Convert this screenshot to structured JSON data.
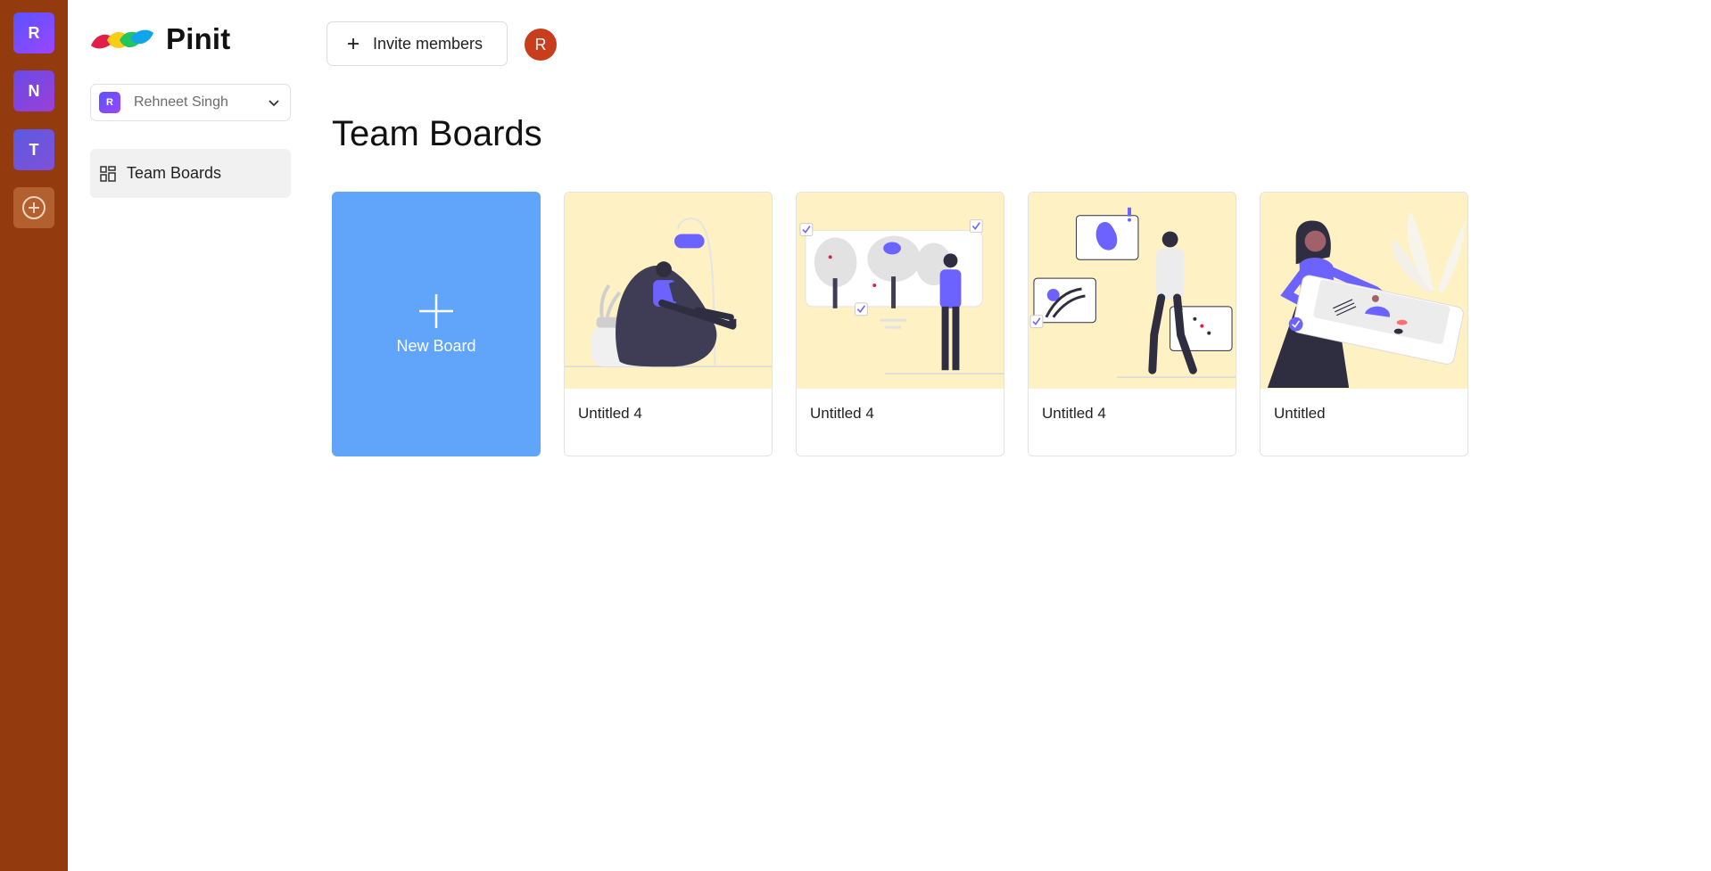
{
  "org_rail": {
    "orgs": [
      {
        "initial": "R"
      },
      {
        "initial": "N"
      },
      {
        "initial": "T"
      }
    ],
    "add_icon": "plus-circle-icon"
  },
  "sidebar": {
    "logo_text": "Pinit",
    "workspace": {
      "avatar_initial": "R",
      "name": "Rehneet Singh",
      "chevron_icon": "chevron-down-icon"
    },
    "nav": [
      {
        "label": "Team Boards",
        "icon": "grid-dashboard-icon"
      }
    ]
  },
  "topbar": {
    "invite_label": "Invite members",
    "invite_icon": "plus-icon",
    "user_initial": "R"
  },
  "main": {
    "title": "Team Boards",
    "new_board_label": "New Board",
    "boards": [
      {
        "title": "Untitled 4",
        "illustration": "person-reading-beanbag"
      },
      {
        "title": "Untitled 4",
        "illustration": "person-viewing-board"
      },
      {
        "title": "Untitled 4",
        "illustration": "person-with-charts"
      },
      {
        "title": "Untitled",
        "illustration": "woman-with-tablet"
      }
    ]
  },
  "colors": {
    "rail": "#933b0f",
    "new_board": "#60a5fa",
    "thumb_bg": "#fef1c4",
    "accent_purple": "#6c63ff",
    "user_avatar": "#c83d1b"
  }
}
